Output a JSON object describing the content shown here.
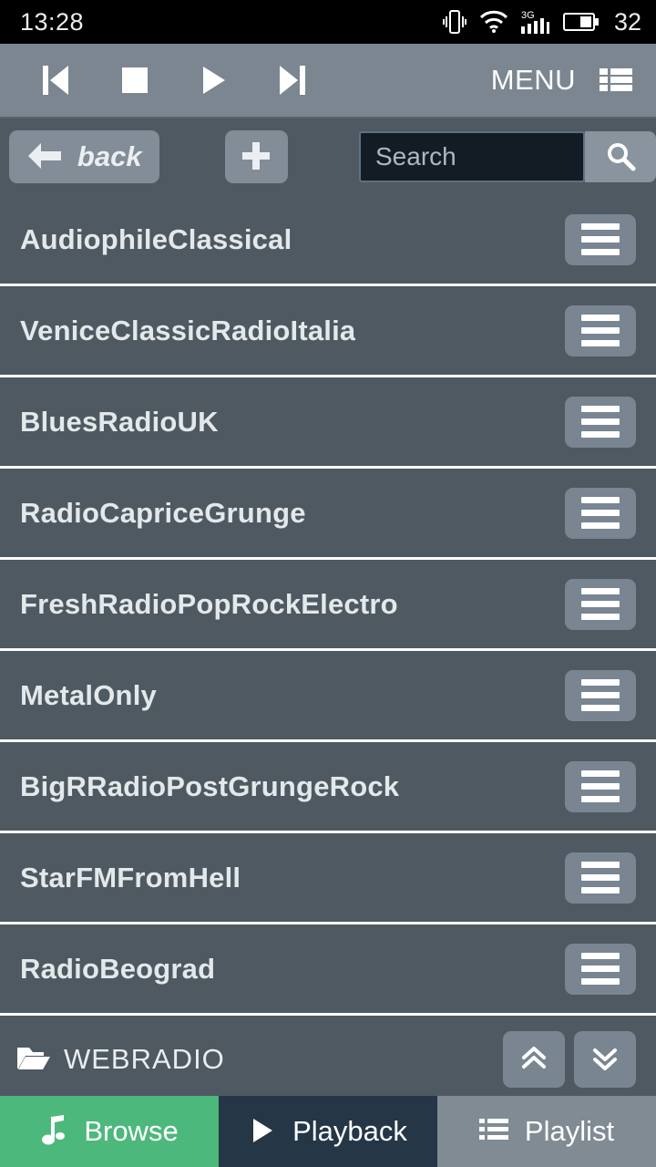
{
  "status_bar": {
    "time": "13:28",
    "battery_level": "32",
    "icons": [
      "vibrate-icon",
      "wifi-icon",
      "signal-3g-icon",
      "battery-icon"
    ]
  },
  "transport_bar": {
    "previous_label": "skip-previous",
    "stop_label": "stop",
    "play_label": "play",
    "next_label": "skip-next",
    "menu_label": "MENU",
    "menu_icon": "list-view-icon"
  },
  "toolbar": {
    "back_label": "back",
    "add_label": "+",
    "search_placeholder": "Search",
    "search_value": "",
    "search_button_icon": "search-icon"
  },
  "list": {
    "items": [
      {
        "name": "AudiophileClassical"
      },
      {
        "name": "VeniceClassicRadioItalia"
      },
      {
        "name": "BluesRadioUK"
      },
      {
        "name": "RadioCapriceGrunge"
      },
      {
        "name": "FreshRadioPopRockElectro"
      },
      {
        "name": "MetalOnly"
      },
      {
        "name": "BigRRadioPostGrungeRock"
      },
      {
        "name": "StarFMFromHell"
      },
      {
        "name": "RadioBeograd"
      }
    ]
  },
  "path_row": {
    "folder_icon": "folder-open-icon",
    "label": "WEBRADIO",
    "scroll_up_icon": "chevron-double-up-icon",
    "scroll_down_icon": "chevron-double-down-icon"
  },
  "bottom_nav": {
    "tabs": [
      {
        "label": "Browse",
        "icon": "music-note-icon",
        "active": true
      },
      {
        "label": "Playback",
        "icon": "play-icon",
        "active": false
      },
      {
        "label": "Playlist",
        "icon": "list-icon",
        "active": false
      }
    ]
  },
  "colors": {
    "page_background": "#4e5962",
    "toolbar_background": "#7b8691",
    "button_gray": "#798591",
    "search_field": "#131c24",
    "accent_green": "#4db87c",
    "navy": "#253647",
    "nav_gray": "#808b94",
    "separator": "#ffffff"
  }
}
